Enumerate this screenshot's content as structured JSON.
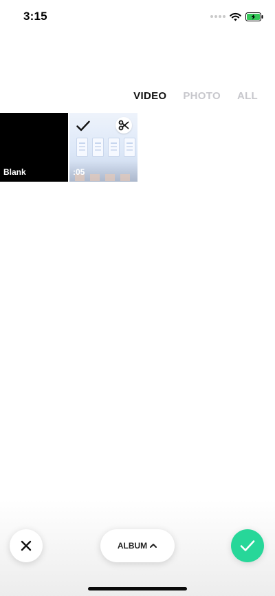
{
  "status_bar": {
    "time": "3:15",
    "icons": [
      "cellular-dots-icon",
      "wifi-icon",
      "battery-charging-icon"
    ]
  },
  "tabs": [
    {
      "label": "VIDEO",
      "active": true
    },
    {
      "label": "PHOTO",
      "active": false
    },
    {
      "label": "ALL",
      "active": false
    }
  ],
  "grid": {
    "blank_tile": {
      "label": "Blank"
    },
    "video_tile": {
      "duration": ":05",
      "selected": true,
      "icons": [
        "checkmark-icon",
        "scissors-icon"
      ]
    }
  },
  "bottom_bar": {
    "album_label": "ALBUM",
    "icons": [
      "close-icon",
      "chevron-up-icon",
      "checkmark-icon"
    ]
  },
  "colors": {
    "confirm_green": "#27d799",
    "tab_active": "#111111",
    "tab_inactive": "#c7c7cc",
    "battery_green": "#34c759"
  }
}
